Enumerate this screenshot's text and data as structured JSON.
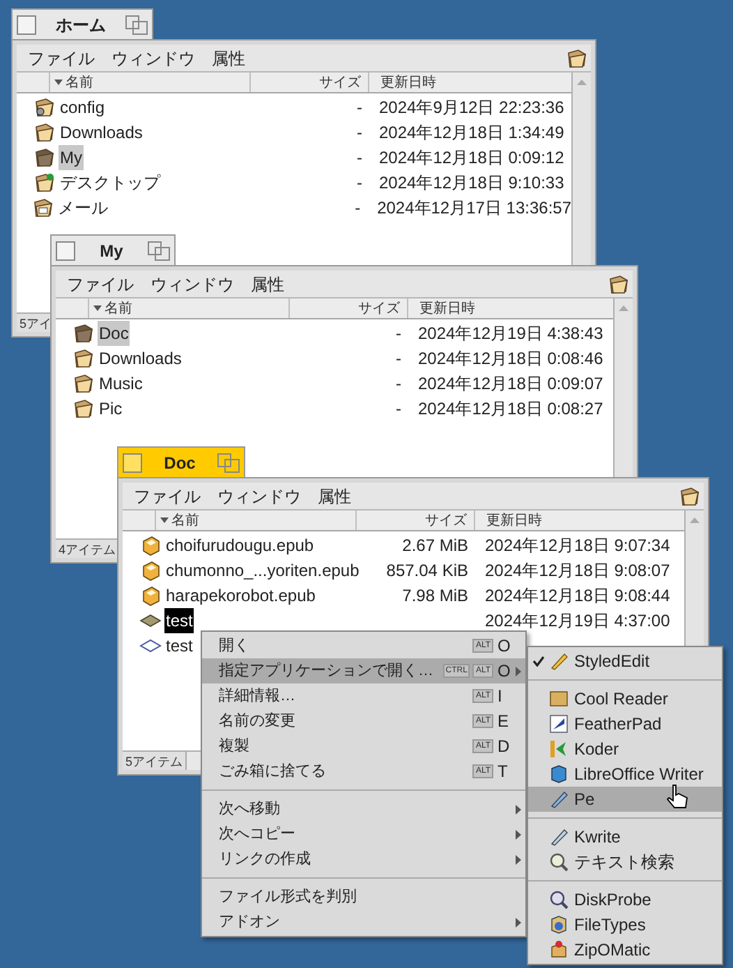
{
  "windows": [
    {
      "title": "ホーム",
      "active": false,
      "menu": [
        "ファイル",
        "ウィンドウ",
        "属性"
      ],
      "columns": [
        "名前",
        "サイズ",
        "更新日時"
      ],
      "status": "5アイ",
      "rows": [
        {
          "kind": "config-folder",
          "name": "config",
          "size": "-",
          "modified": "2024年9月12日 22:23:36",
          "selected": false
        },
        {
          "kind": "folder",
          "name": "Downloads",
          "size": "-",
          "modified": "2024年12月18日 1:34:49",
          "selected": false
        },
        {
          "kind": "folder",
          "name": "My",
          "size": "-",
          "modified": "2024年12月18日 0:09:12",
          "selected": true
        },
        {
          "kind": "desktop-folder",
          "name": "デスクトップ",
          "size": "-",
          "modified": "2024年12月18日 9:10:33",
          "selected": false
        },
        {
          "kind": "mail-folder",
          "name": "メール",
          "size": "-",
          "modified": "2024年12月17日 13:36:57",
          "selected": false
        }
      ]
    },
    {
      "title": "My",
      "active": false,
      "menu": [
        "ファイル",
        "ウィンドウ",
        "属性"
      ],
      "columns": [
        "名前",
        "サイズ",
        "更新日時"
      ],
      "status": "4アイテム",
      "rows": [
        {
          "kind": "folder",
          "name": "Doc",
          "size": "-",
          "modified": "2024年12月19日 4:38:43",
          "selected": true
        },
        {
          "kind": "folder",
          "name": "Downloads",
          "size": "-",
          "modified": "2024年12月18日 0:08:46",
          "selected": false
        },
        {
          "kind": "folder",
          "name": "Music",
          "size": "-",
          "modified": "2024年12月18日 0:09:07",
          "selected": false
        },
        {
          "kind": "folder",
          "name": "Pic",
          "size": "-",
          "modified": "2024年12月18日 0:08:27",
          "selected": false
        }
      ]
    },
    {
      "title": "Doc",
      "active": true,
      "menu": [
        "ファイル",
        "ウィンドウ",
        "属性"
      ],
      "columns": [
        "名前",
        "サイズ",
        "更新日時"
      ],
      "status": "5アイテム",
      "rows": [
        {
          "kind": "book",
          "name": "choifurudougu.epub",
          "size": "2.67 MiB",
          "modified": "2024年12月18日 9:07:34",
          "selected": false
        },
        {
          "kind": "book",
          "name": "chumonno_...yoriten.epub",
          "size": "857.04 KiB",
          "modified": "2024年12月18日 9:08:07",
          "selected": false
        },
        {
          "kind": "book",
          "name": "harapekorobot.epub",
          "size": "7.98 MiB",
          "modified": "2024年12月18日 9:08:44",
          "selected": false
        },
        {
          "kind": "text-file",
          "name": "test",
          "modified": "2024年12月19日 4:37:00",
          "selected": true
        },
        {
          "kind": "file",
          "name": "test",
          "selected": false
        }
      ]
    }
  ],
  "context_menu": [
    {
      "kind": "item",
      "label": "開く",
      "modifiers": [
        "ALT"
      ],
      "key": "O",
      "submenu": false,
      "selected": false
    },
    {
      "kind": "item",
      "label": "指定アプリケーションで開く…",
      "modifiers": [
        "CTRL",
        "ALT"
      ],
      "key": "O",
      "submenu": true,
      "selected": true
    },
    {
      "kind": "item",
      "label": "詳細情報…",
      "modifiers": [
        "ALT"
      ],
      "key": "I",
      "submenu": false,
      "selected": false
    },
    {
      "kind": "item",
      "label": "名前の変更",
      "modifiers": [
        "ALT"
      ],
      "key": "E",
      "submenu": false,
      "selected": false
    },
    {
      "kind": "item",
      "label": "複製",
      "modifiers": [
        "ALT"
      ],
      "key": "D",
      "submenu": false,
      "selected": false
    },
    {
      "kind": "item",
      "label": "ごみ箱に捨てる",
      "modifiers": [
        "ALT"
      ],
      "key": "T",
      "submenu": false,
      "selected": false
    },
    {
      "kind": "separator"
    },
    {
      "kind": "item",
      "label": "次へ移動",
      "submenu": true,
      "selected": false
    },
    {
      "kind": "item",
      "label": "次へコピー",
      "submenu": true,
      "selected": false
    },
    {
      "kind": "item",
      "label": "リンクの作成",
      "submenu": true,
      "selected": false
    },
    {
      "kind": "separator"
    },
    {
      "kind": "item",
      "label": "ファイル形式を判別",
      "submenu": false,
      "selected": false
    },
    {
      "kind": "item",
      "label": "アドオン",
      "submenu": true,
      "selected": false
    }
  ],
  "open_with_menu": [
    {
      "kind": "item",
      "label": "StyledEdit",
      "checked": true,
      "selected": false
    },
    {
      "kind": "separator"
    },
    {
      "kind": "item",
      "label": "Cool Reader",
      "checked": false,
      "selected": false
    },
    {
      "kind": "item",
      "label": "FeatherPad",
      "checked": false,
      "selected": false
    },
    {
      "kind": "item",
      "label": "Koder",
      "checked": false,
      "selected": false
    },
    {
      "kind": "item",
      "label": "LibreOffice Writer",
      "checked": false,
      "selected": false
    },
    {
      "kind": "item",
      "label": "Pe",
      "checked": false,
      "selected": true
    },
    {
      "kind": "separator"
    },
    {
      "kind": "item",
      "label": "Kwrite",
      "checked": false,
      "selected": false
    },
    {
      "kind": "item",
      "label": "テキスト検索",
      "checked": false,
      "selected": false
    },
    {
      "kind": "separator"
    },
    {
      "kind": "item",
      "label": "DiskProbe",
      "checked": false,
      "selected": false
    },
    {
      "kind": "item",
      "label": "FileTypes",
      "checked": false,
      "selected": false
    },
    {
      "kind": "item",
      "label": "ZipOMatic",
      "checked": false,
      "selected": false
    }
  ]
}
